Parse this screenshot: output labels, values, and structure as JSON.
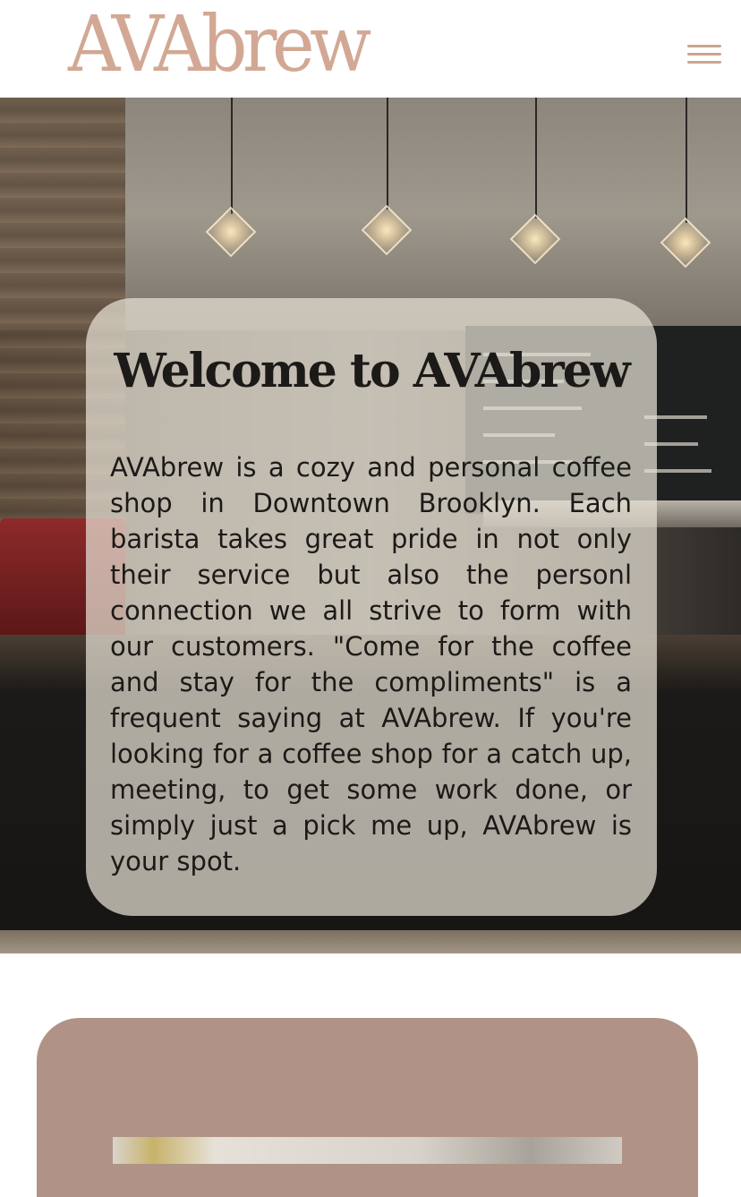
{
  "header": {
    "logo_text": "AVAbrew",
    "logo_color": "#d2a894",
    "menu_icon": "hamburger-menu-icon"
  },
  "hero": {
    "welcome": {
      "title": "Welcome to AVAbrew",
      "body": "AVAbrew is a cozy and personal coffee shop in Downtown Brooklyn. Each barista takes great pride in not only their service but also the personl connection we all strive to form with our customers. \"Come for the coffee and stay for the compliments\" is a frequent saying at AVAbrew. If you're looking for a coffee shop for a catch up, meeting, to get some work done, or simply just a pick me up, AVAbrew is your spot."
    }
  },
  "colors": {
    "accent": "#d2a894",
    "card_overlay": "#e8e2d6",
    "lower_section": "#b09386"
  }
}
